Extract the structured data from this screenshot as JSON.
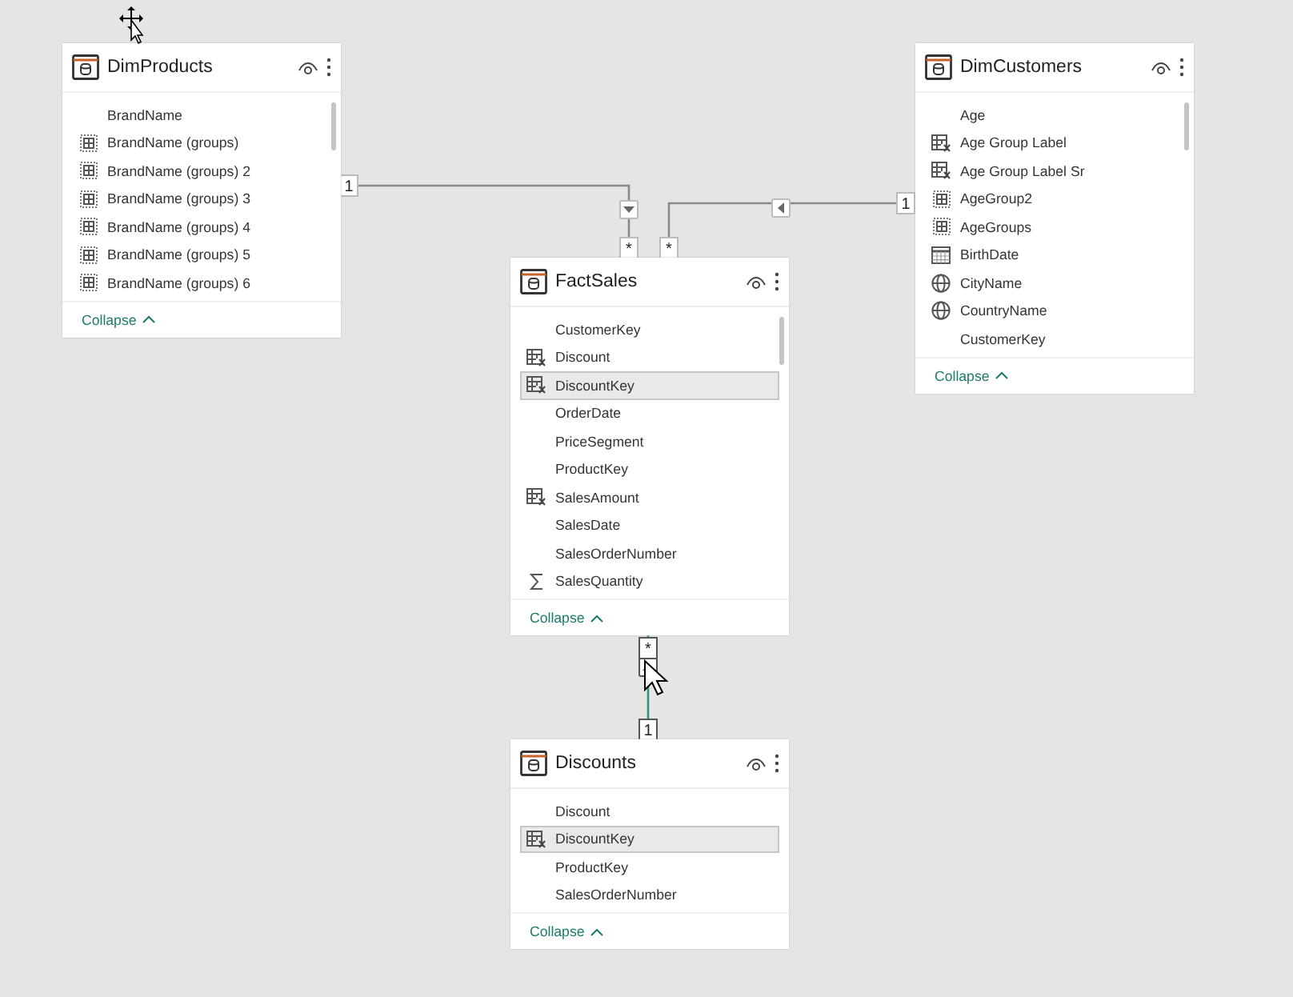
{
  "tables": [
    {
      "name": "DimProducts",
      "collapse_label": "Collapse",
      "fields": [
        {
          "label": "BrandName",
          "kind": "plain",
          "selected": false
        },
        {
          "label": "BrandName (groups)",
          "kind": "group",
          "selected": false
        },
        {
          "label": "BrandName (groups) 2",
          "kind": "group",
          "selected": false
        },
        {
          "label": "BrandName (groups) 3",
          "kind": "group",
          "selected": false
        },
        {
          "label": "BrandName (groups) 4",
          "kind": "group",
          "selected": false
        },
        {
          "label": "BrandName (groups) 5",
          "kind": "group",
          "selected": false
        },
        {
          "label": "BrandName (groups) 6",
          "kind": "group",
          "selected": false
        }
      ]
    },
    {
      "name": "DimCustomers",
      "collapse_label": "Collapse",
      "fields": [
        {
          "label": "Age",
          "kind": "plain",
          "selected": false
        },
        {
          "label": "Age Group Label",
          "kind": "calc",
          "selected": false
        },
        {
          "label": "Age Group Label Sr",
          "kind": "calc",
          "selected": false
        },
        {
          "label": "AgeGroup2",
          "kind": "group",
          "selected": false
        },
        {
          "label": "AgeGroups",
          "kind": "group",
          "selected": false
        },
        {
          "label": "BirthDate",
          "kind": "date",
          "selected": false
        },
        {
          "label": "CityName",
          "kind": "geo",
          "selected": false
        },
        {
          "label": "CountryName",
          "kind": "geo",
          "selected": false
        },
        {
          "label": "CustomerKey",
          "kind": "plain",
          "selected": false
        }
      ]
    },
    {
      "name": "FactSales",
      "collapse_label": "Collapse",
      "fields": [
        {
          "label": "CustomerKey",
          "kind": "plain",
          "selected": false
        },
        {
          "label": "Discount",
          "kind": "calc",
          "selected": false
        },
        {
          "label": "DiscountKey",
          "kind": "calc",
          "selected": true
        },
        {
          "label": "OrderDate",
          "kind": "plain",
          "selected": false
        },
        {
          "label": "PriceSegment",
          "kind": "plain",
          "selected": false
        },
        {
          "label": "ProductKey",
          "kind": "plain",
          "selected": false
        },
        {
          "label": "SalesAmount",
          "kind": "calc",
          "selected": false
        },
        {
          "label": "SalesDate",
          "kind": "plain",
          "selected": false
        },
        {
          "label": "SalesOrderNumber",
          "kind": "plain",
          "selected": false
        },
        {
          "label": "SalesQuantity",
          "kind": "sum",
          "selected": false
        }
      ]
    },
    {
      "name": "Discounts",
      "collapse_label": "Collapse",
      "fields": [
        {
          "label": "Discount",
          "kind": "plain",
          "selected": false
        },
        {
          "label": "DiscountKey",
          "kind": "calc",
          "selected": true
        },
        {
          "label": "ProductKey",
          "kind": "plain",
          "selected": false
        },
        {
          "label": "SalesOrderNumber",
          "kind": "plain",
          "selected": false
        }
      ]
    }
  ],
  "relationships": [
    {
      "one_label": "1",
      "many_label": "*",
      "kind": "down",
      "selected": false
    },
    {
      "one_label": "1",
      "many_label": "*",
      "kind": "left",
      "selected": false
    },
    {
      "one_label": "1",
      "many_label": "*",
      "kind": "up",
      "selected": true
    }
  ]
}
